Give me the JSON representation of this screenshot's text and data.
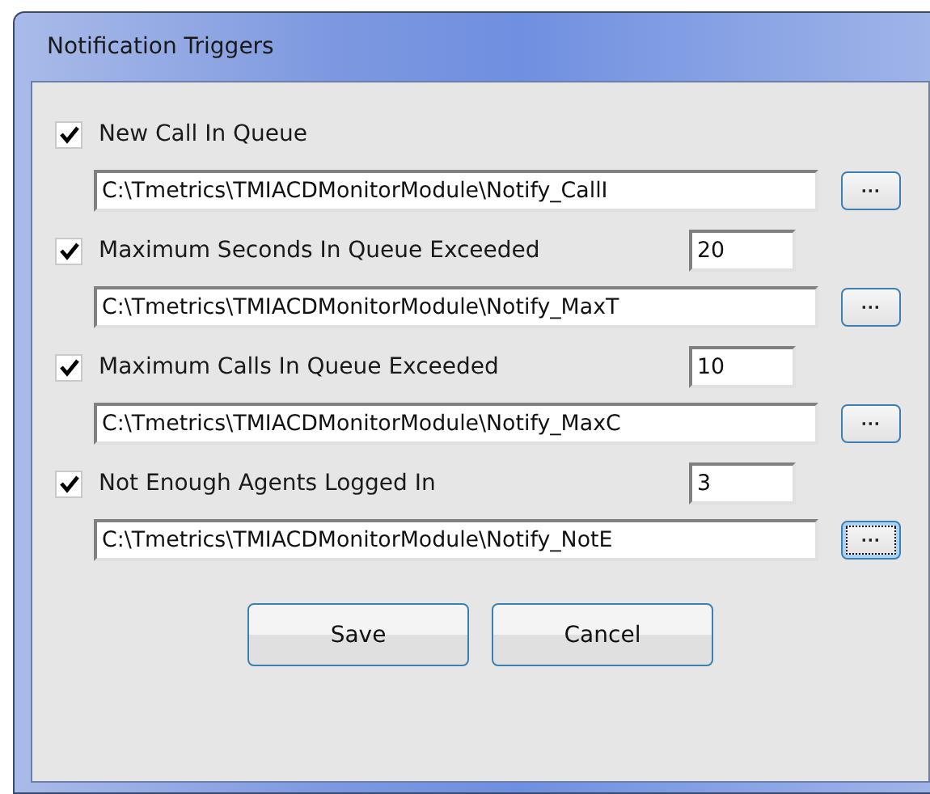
{
  "window": {
    "title": "Notification Triggers"
  },
  "triggers": [
    {
      "label": "New Call In Queue",
      "checked": true,
      "path": "C:\\Tmetrics\\TMIACDMonitorModule\\Notify_CallI",
      "browse": "···",
      "focused": false
    },
    {
      "label": "Maximum Seconds In Queue Exceeded",
      "checked": true,
      "threshold": "20",
      "path": "C:\\Tmetrics\\TMIACDMonitorModule\\Notify_MaxT",
      "browse": "···",
      "focused": false
    },
    {
      "label": "Maximum Calls In Queue Exceeded",
      "checked": true,
      "threshold": "10",
      "path": "C:\\Tmetrics\\TMIACDMonitorModule\\Notify_MaxC",
      "browse": "···",
      "focused": false
    },
    {
      "label": "Not Enough Agents Logged In",
      "checked": true,
      "threshold": "3",
      "path": "C:\\Tmetrics\\TMIACDMonitorModule\\Notify_NotE",
      "browse": "···",
      "focused": true
    }
  ],
  "buttons": [
    "Save",
    "Cancel"
  ]
}
